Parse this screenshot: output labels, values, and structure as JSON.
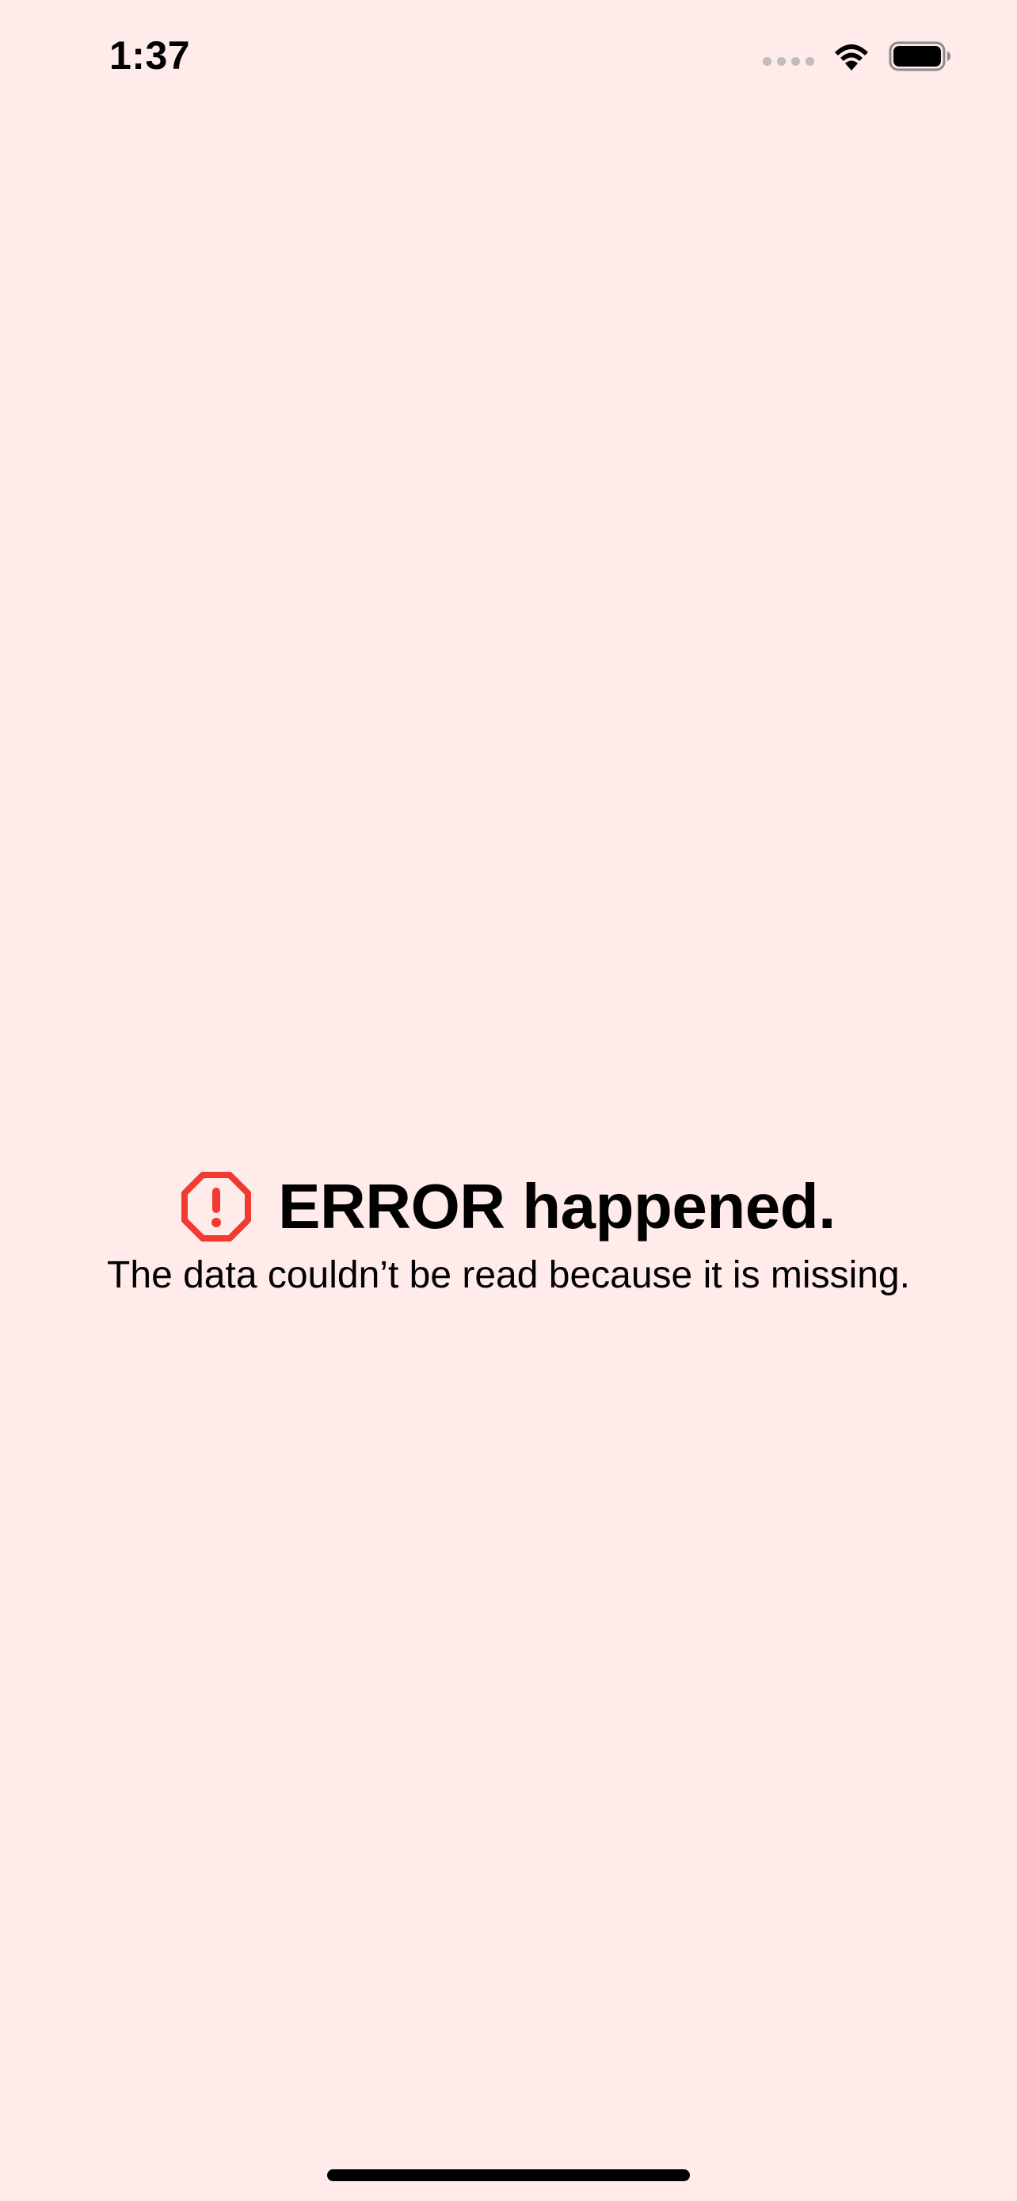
{
  "status_bar": {
    "time": "1:37",
    "icons": [
      "signal-icon",
      "wifi-icon",
      "battery-icon"
    ]
  },
  "error": {
    "icon": "exclamationmark-octagon-icon",
    "title": "ERROR happened.",
    "message": "The data couldn’t be read because it is missing."
  },
  "colors": {
    "background": "#FEEBEA",
    "error_icon": "#F23B30",
    "text": "#000000"
  }
}
